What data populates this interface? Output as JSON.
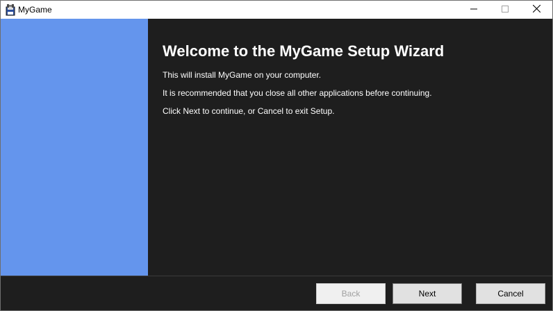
{
  "window": {
    "title": "MyGame",
    "app_icon": "installer-floppy-icon",
    "controls": {
      "minimize_icon": "minimize-icon",
      "maximize_icon": "maximize-icon",
      "close_icon": "close-icon"
    }
  },
  "sidebar": {
    "color": "#6495ED"
  },
  "wizard": {
    "heading": "Welcome to the MyGame Setup Wizard",
    "paragraphs": [
      "This will install MyGame on your computer.",
      "It is recommended that you close all other applications before continuing.",
      "Click Next to continue, or Cancel to exit Setup."
    ]
  },
  "buttons": {
    "back": "Back",
    "next": "Next",
    "cancel": "Cancel",
    "back_enabled": false
  },
  "colors": {
    "content_bg": "#1E1E1E",
    "text": "#FFFFFF",
    "titlebar_bg": "#FFFFFF"
  }
}
